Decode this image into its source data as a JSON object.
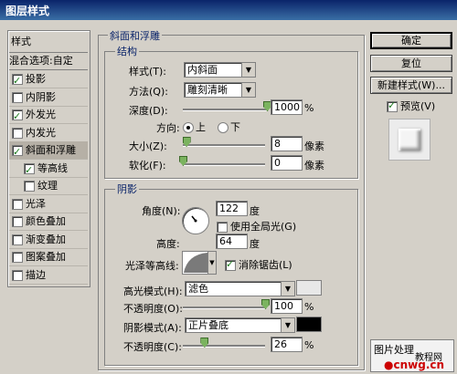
{
  "window": {
    "title": "图层样式"
  },
  "sidebar": {
    "header": "样式",
    "blend_options": "混合选项:自定",
    "items": [
      {
        "label": "投影",
        "checked": true,
        "selected": false,
        "sub": false
      },
      {
        "label": "内阴影",
        "checked": false,
        "selected": false,
        "sub": false
      },
      {
        "label": "外发光",
        "checked": true,
        "selected": false,
        "sub": false
      },
      {
        "label": "内发光",
        "checked": false,
        "selected": false,
        "sub": false
      },
      {
        "label": "斜面和浮雕",
        "checked": true,
        "selected": true,
        "sub": false
      },
      {
        "label": "等高线",
        "checked": true,
        "selected": false,
        "sub": true
      },
      {
        "label": "纹理",
        "checked": false,
        "selected": false,
        "sub": true
      },
      {
        "label": "光泽",
        "checked": false,
        "selected": false,
        "sub": false
      },
      {
        "label": "颜色叠加",
        "checked": false,
        "selected": false,
        "sub": false
      },
      {
        "label": "渐变叠加",
        "checked": false,
        "selected": false,
        "sub": false
      },
      {
        "label": "图案叠加",
        "checked": false,
        "selected": false,
        "sub": false
      },
      {
        "label": "描边",
        "checked": false,
        "selected": false,
        "sub": false
      }
    ]
  },
  "bevel": {
    "section_title": "斜面和浮雕",
    "structure_title": "结构",
    "style_label": "样式(T):",
    "style_value": "内斜面",
    "technique_label": "方法(Q):",
    "technique_value": "雕刻清晰",
    "depth_label": "深度(D):",
    "depth_value": "1000",
    "depth_unit": "%",
    "depth_level": 1.0,
    "direction_label": "方向:",
    "direction_up": "上",
    "direction_down": "下",
    "direction_selected": "up",
    "size_label": "大小(Z):",
    "size_value": "8",
    "size_unit": "像素",
    "size_level": 0.04,
    "soften_label": "软化(F):",
    "soften_value": "0",
    "soften_unit": "像素",
    "soften_level": 0.0
  },
  "shading": {
    "title": "阴影",
    "angle_label": "角度(N):",
    "angle_value": "122",
    "angle_unit": "度",
    "global_light_label": "使用全局光(G)",
    "global_light_checked": false,
    "altitude_label": "高度:",
    "altitude_value": "64",
    "altitude_unit": "度",
    "gloss_label": "光泽等高线:",
    "antialias_label": "消除锯齿(L)",
    "antialias_checked": true,
    "highlight_mode_label": "高光模式(H):",
    "highlight_mode_value": "滤色",
    "highlight_color": "#e8e8e8",
    "highlight_opacity_label": "不透明度(O):",
    "highlight_opacity_value": "100",
    "highlight_opacity_unit": "%",
    "highlight_opacity_level": 1.0,
    "shadow_mode_label": "阴影模式(A):",
    "shadow_mode_value": "正片叠底",
    "shadow_color": "#000000",
    "shadow_opacity_label": "不透明度(C):",
    "shadow_opacity_value": "26",
    "shadow_opacity_unit": "%",
    "shadow_opacity_level": 0.26
  },
  "buttons": {
    "ok": "确定",
    "reset": "复位",
    "new_style": "新建样式(W)...",
    "preview_label": "预览(V)",
    "preview_checked": true
  },
  "watermark": {
    "line1": "图片处理",
    "line2": "教程网",
    "url": "cnwg.cn"
  }
}
